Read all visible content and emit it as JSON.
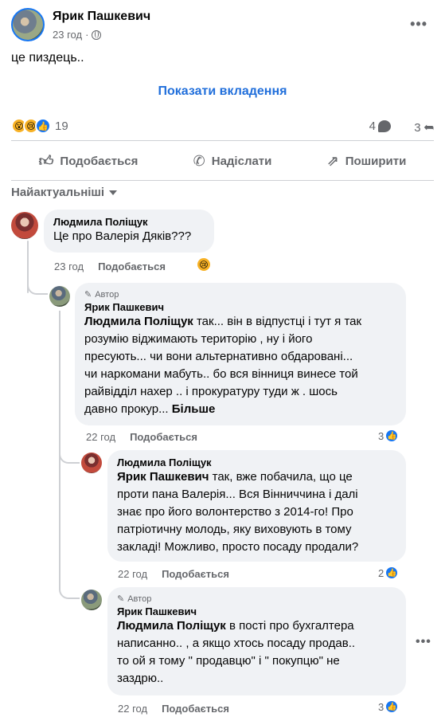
{
  "post": {
    "author": "Ярик Пашкевич",
    "time": "23 год",
    "separator": "·",
    "text": "це пиздець..",
    "show_attachments": "Показати вкладення",
    "reactions_count": "19",
    "comments_count": "4",
    "shares_count": "3"
  },
  "actions": {
    "like": "Подобається",
    "send": "Надіслати",
    "share": "Поширити"
  },
  "sort": {
    "label": "Найактуальніші"
  },
  "comments": [
    {
      "name": "Людмила Поліщук",
      "text": "Це про Валерія Дяків???",
      "time": "23 год",
      "like": "Подобається"
    },
    {
      "badge": "Автор",
      "name": "Ярик Пашкевич",
      "mention": "Людмила Поліщук",
      "text_l1": " так... він в відпустці і тут я так",
      "text_l2": "розумію віджимають територію , ну і його",
      "text_l3": "пресують... чи вони альтернативно обдаровані...",
      "text_l4": "чи наркомани мабуть.. бо вся вінниця винесе той",
      "text_l5": "райвідділ нахер .. і прокуратуру туди ж . шось",
      "text_l6": "давно прокур... ",
      "more": "Більше",
      "time": "22 год",
      "like": "Подобається",
      "reactions": "3"
    },
    {
      "name": "Людмила Поліщук",
      "mention": "Ярик Пашкевич",
      "text_l1": " так, вже побачила, що це",
      "text_l2": "проти пана Валерія... Вся Вінниччина і далі",
      "text_l3": "знає про його волонтерство з 2014-го! Про",
      "text_l4": "патріотичну молодь, яку виховують в тому",
      "text_l5": "закладі! Можливо, просто посаду продали?",
      "time": "22 год",
      "like": "Подобається",
      "reactions": "2"
    },
    {
      "badge": "Автор",
      "name": "Ярик Пашкевич",
      "mention": "Людмила Поліщук",
      "text_l1": " в пості про бухгалтера",
      "text_l2": "написанно.. , а якщо хтось посаду продав..",
      "text_l3": "то ой я тому \" продавцю\" і \" покупцю\" не",
      "text_l4": "заздрю..",
      "time": "22 год",
      "like": "Подобається",
      "reactions": "3"
    }
  ],
  "colors": {
    "link_blue": "#216fdb",
    "like_blue": "#1877f2",
    "muted": "#65676b",
    "bubble": "#f0f2f5"
  }
}
